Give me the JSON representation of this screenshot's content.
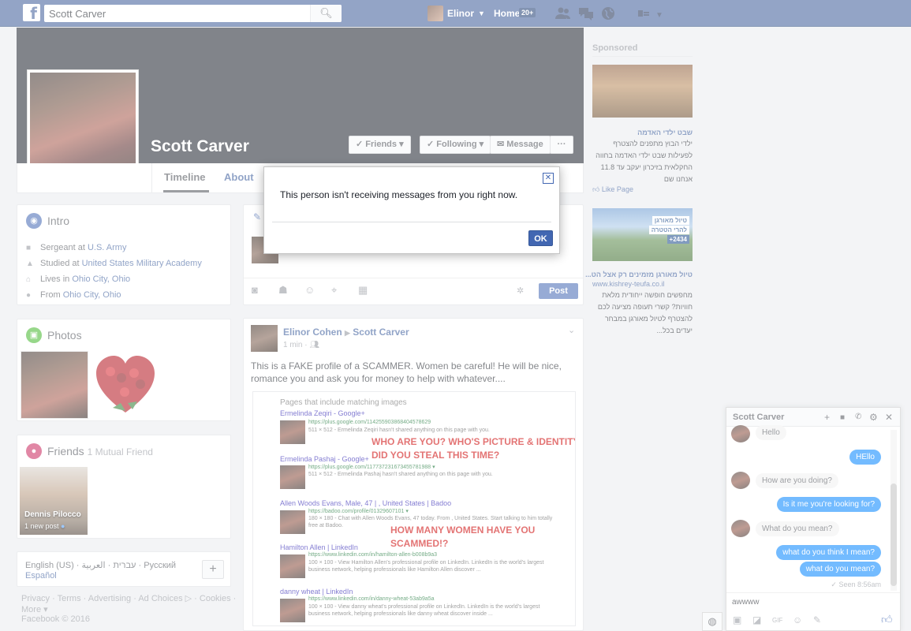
{
  "topbar": {
    "logo": "f",
    "search_value": "Scott Carver",
    "user_name": "Elinor",
    "home_label": "Home",
    "home_badge": "20+"
  },
  "profile": {
    "name": "Scott Carver",
    "buttons": {
      "friends": "Friends",
      "following": "Following",
      "message": "Message",
      "more": "···"
    },
    "tabs": [
      "Timeline",
      "About"
    ]
  },
  "intro": {
    "title": "Intro",
    "rows": [
      {
        "prefix": "Sergeant at ",
        "link": "U.S. Army"
      },
      {
        "prefix": "Studied at ",
        "link": "United States Military Academy"
      },
      {
        "prefix": "Lives in ",
        "link": "Ohio City, Ohio"
      },
      {
        "prefix": "From ",
        "link": "Ohio City, Ohio"
      }
    ]
  },
  "photos": {
    "title": "Photos"
  },
  "friends": {
    "title": "Friends",
    "mutual": "1 Mutual Friend",
    "tile_name": "Dennis Pilocco",
    "tile_sub": "1 new post"
  },
  "languages": {
    "line1": "English (US) · עברית · العربية · Русский",
    "line2": "Español"
  },
  "footer": {
    "line1": "Privacy · Terms · Advertising · Ad Choices ▷ · Cookies ·",
    "line2": "More ▾",
    "line3": "Facebook © 2016"
  },
  "composer": {
    "post_label": "Post"
  },
  "post": {
    "author": "Elinor Cohen",
    "arrow": "▶",
    "target": "Scott Carver",
    "time": "1 min",
    "text": "This is a FAKE profile of a SCAMMER. Women be careful! He will be nice, romance you and ask you for money to help with whatever....",
    "image": {
      "heading": "Pages that include matching images",
      "results": [
        {
          "title": "Ermelinda Zeqiri - Google+",
          "url": "https://plus.google.com/114255903868404578629",
          "desc": "511 × 512 - Ermelinda Zeqiri hasn't shared anything on this page with you."
        },
        {
          "title": "Ermelinda Pashaj - Google+",
          "url": "https://plus.google.com/117737231673455781988 ▾",
          "desc": "511 × 512 - Ermelinda Pashaj hasn't shared anything on this page with you."
        },
        {
          "title": "Allen Woods Evans, Male, 47 | , United States | Badoo",
          "url": "https://badoo.com/profile/01329607101 ▾",
          "desc": "180 × 180 - Chat with Allen Woods Evans, 47 today. From , United States. Start talking to him totally free at Badoo."
        },
        {
          "title": "Hamilton Allen | LinkedIn",
          "url": "https://www.linkedin.com/in/hamilton-allen-b008b9a3",
          "desc": "100 × 100 - View Hamilton Allen's professional profile on LinkedIn. LinkedIn is the world's largest business network, helping professionals like Hamilton Allen discover ..."
        },
        {
          "title": "danny wheat | LinkedIn",
          "url": "https://www.linkedin.com/in/danny-wheat-53ab9a5a",
          "desc": "100 × 100 - View danny wheat's professional profile on LinkedIn. LinkedIn is the world's largest business network, helping professionals like danny wheat discover inside ..."
        }
      ],
      "warn1_a": "WHO ARE YOU? WHO'S PICTURE & IDENTITY",
      "warn1_b": "DID YOU STEAL THIS TIME?",
      "warn2_a": "HOW MANY WOMEN HAVE YOU",
      "warn2_b": "SCAMMED!?"
    }
  },
  "sidebar": {
    "sponsored": "Sponsored",
    "ad1": {
      "title": "שבט ילדי האדמה",
      "body": "ילדי הבוץ מתפנים להצטרף לפעילות שבט ילדי האדמה בחווה החקלאית בזיכרון יעקב עד 11.8 אנחנו שם",
      "like": "Like Page"
    },
    "ad2": {
      "img_text1": "טיול מאורגן",
      "img_text2": "להרי הטטרה",
      "img_price": "+2434",
      "title": "טיול מאורגן מזמינים רק אצל הט...",
      "url": "www.kishrey-teufa.co.il",
      "body": "מחפשים חופשה ייחודית מלאת חוויות? קשרי תעופה מציעה לכם להצטרף לטיול מאורגן במבחר יעדים בכל..."
    }
  },
  "dialog": {
    "message": "This person isn't receiving messages from you right now.",
    "ok_label": "OK"
  },
  "chat": {
    "name": "Scott Carver",
    "messages": [
      {
        "dir": "in",
        "text": "Hello"
      },
      {
        "dir": "out",
        "text": "HEllo"
      },
      {
        "dir": "in",
        "text": "How are you doing?"
      },
      {
        "dir": "out",
        "text": "Is it me you're looking for?"
      },
      {
        "dir": "in",
        "text": "What do you mean?"
      },
      {
        "dir": "out",
        "text": "what do you think I mean?"
      },
      {
        "dir": "out",
        "text": "what do you mean?"
      }
    ],
    "seen": "✓ Seen 8:56am",
    "input_value": "awwww"
  }
}
